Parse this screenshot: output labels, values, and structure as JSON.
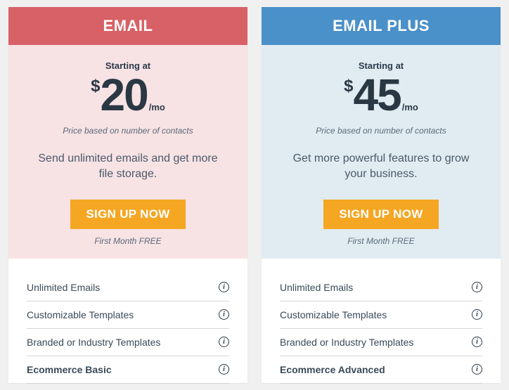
{
  "plans": [
    {
      "title": "EMAIL",
      "starting": "Starting at",
      "currency": "$",
      "amount": "20",
      "per": "/mo",
      "note": "Price based on number of contacts",
      "desc": "Send unlimited emails and get more file storage.",
      "cta": "SIGN UP NOW",
      "free": "First Month FREE",
      "features": [
        {
          "label": "Unlimited Emails",
          "bold": false
        },
        {
          "label": "Customizable Templates",
          "bold": false
        },
        {
          "label": "Branded or Industry Templates",
          "bold": false
        },
        {
          "label": "Ecommerce Basic",
          "bold": true
        }
      ]
    },
    {
      "title": "EMAIL PLUS",
      "starting": "Starting at",
      "currency": "$",
      "amount": "45",
      "per": "/mo",
      "note": "Price based on number of contacts",
      "desc": "Get more powerful features to grow your business.",
      "cta": "SIGN UP NOW",
      "free": "First Month FREE",
      "features": [
        {
          "label": "Unlimited Emails",
          "bold": false
        },
        {
          "label": "Customizable Templates",
          "bold": false
        },
        {
          "label": "Branded or Industry Templates",
          "bold": false
        },
        {
          "label": "Ecommerce Advanced",
          "bold": true
        }
      ]
    }
  ]
}
